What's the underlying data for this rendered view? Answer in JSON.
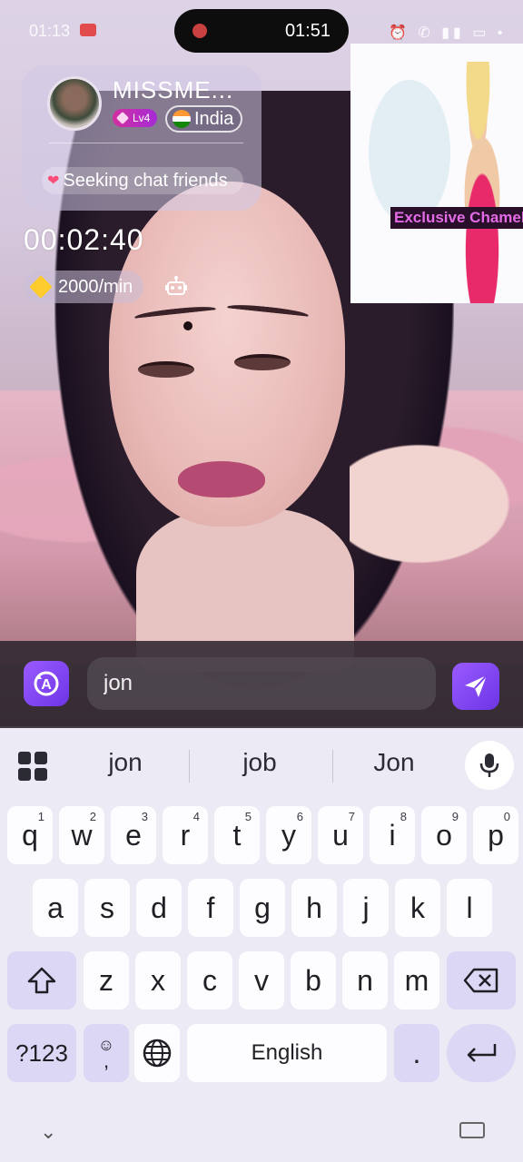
{
  "status_bar": {
    "time": "01:13",
    "icons": "⏰ ✆ ▮▮ ▭ •"
  },
  "call": {
    "timer": "01:51",
    "duration": "00:02:40",
    "rate": "2000/min"
  },
  "profile": {
    "username": "MISSME...",
    "level": "Lv4",
    "country": "India",
    "status": "Seeking chat friends"
  },
  "preview": {
    "caption": "Exclusive Chameleon"
  },
  "input": {
    "value": "jon"
  },
  "keyboard": {
    "suggestions": [
      "jon",
      "job",
      "Jon"
    ],
    "row1": [
      {
        "k": "q",
        "n": "1"
      },
      {
        "k": "w",
        "n": "2"
      },
      {
        "k": "e",
        "n": "3"
      },
      {
        "k": "r",
        "n": "4"
      },
      {
        "k": "t",
        "n": "5"
      },
      {
        "k": "y",
        "n": "6"
      },
      {
        "k": "u",
        "n": "7"
      },
      {
        "k": "i",
        "n": "8"
      },
      {
        "k": "o",
        "n": "9"
      },
      {
        "k": "p",
        "n": "0"
      }
    ],
    "row2": [
      "a",
      "s",
      "d",
      "f",
      "g",
      "h",
      "j",
      "k",
      "l"
    ],
    "row3": [
      "z",
      "x",
      "c",
      "v",
      "b",
      "n",
      "m"
    ],
    "symbols_label": "?123",
    "emoji_comma": ",",
    "space_label": "English",
    "period": "."
  },
  "colors": {
    "accent": "#7c42f0",
    "key_fn": "#dcd7f4",
    "keyboard_bg": "#eceaf4"
  }
}
